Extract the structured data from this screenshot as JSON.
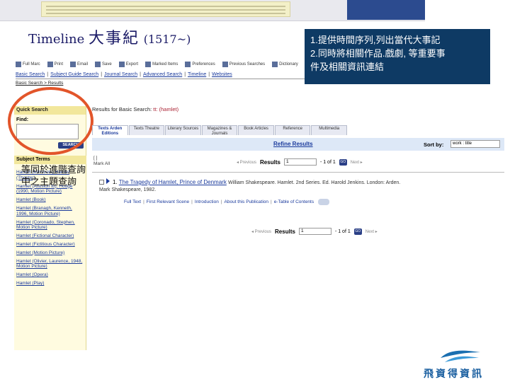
{
  "slide": {
    "title_en": "Timeline",
    "title_zh": "大事紀",
    "title_years": "(1517~)",
    "callout_lines": [
      "1.提供時間序列,列出當代大事記",
      "2.同時將相關作品.戲劇, 等重要事",
      "件及相關資訊連結"
    ],
    "annotation_lines": [
      "等同於進階查詢",
      "中之主題查詢"
    ],
    "logo_text": "飛資得資訊"
  },
  "toolbar": [
    "Full Marc",
    "Print",
    "Email",
    "Save",
    "Export",
    "Marked Items",
    "Preferences",
    "Previous Searches",
    "Dictionary"
  ],
  "nav": {
    "links": [
      "Basic Search",
      "Subject Guide Search",
      "Journal Search",
      "Advanced Search",
      "Timeline",
      "Websites"
    ],
    "breadcrumb": "Basic Search > Results"
  },
  "sidebar": {
    "quick_search_label": "Quick Search",
    "find_label": "Find:",
    "search_button": "SEARCH",
    "subject_terms_label": "Subject Terms",
    "subject_terms": [
      "Hamlet (Minstrels) Hamlet (Theater)",
      "Hamlet (Allusion to), Hodge (1990, Motion Picture)",
      "Hamlet (Book)",
      "Hamlet (Branagh, Kenneth, 1996, Motion Picture)",
      "Hamlet (Coronado, Stephen, Motion Picture)",
      "Hamlet (Fictional Character)",
      "Hamlet (Fictitious Character)",
      "Hamlet (Motion Picture)",
      "Hamlet (Olivier, Laurence, 1948, Motion Picture)",
      "Hamlet (Opera)",
      "Hamlet (Play)"
    ]
  },
  "results": {
    "heading_prefix": "Results for Basic Search:",
    "heading_query": "tt: (hamlet)",
    "tabs": [
      "Texts Arden Editions",
      "Texts Theatre",
      "Literary Sources",
      "Magazines & Journals",
      "Book Articles",
      "Reference",
      "Multimedia"
    ],
    "refine_label": "Refine Results",
    "sort_label": "Sort by:",
    "sort_value": "work : title",
    "all_label_lines": [
      "[ ]",
      "Mark All"
    ],
    "pager": {
      "previous": "◂ Previous",
      "label": "Results",
      "value_top": "1",
      "value_bottom": "1",
      "range": "- 1  of  1",
      "go": "GO",
      "next": "Next ▸"
    },
    "item": {
      "number": "1.",
      "title": "The Tragedy of Hamlet, Prince of Denmark",
      "meta_line1": "William Shakespeare. Hamlet. 2nd Series. Ed. Harold Jenkins. London: Arden.",
      "meta_line2": "Mark   Shakespeare, 1982.",
      "links": [
        "Full Text",
        "First Relevant Scene",
        "Introduction",
        "About this Publication",
        "e-Table of Contents"
      ]
    }
  }
}
